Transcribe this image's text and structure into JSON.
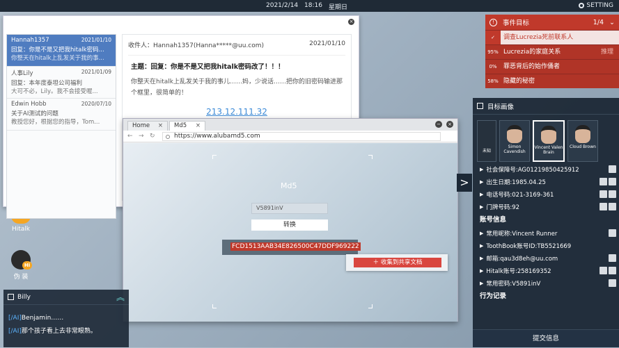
{
  "topbar": {
    "date": "2021/2/14",
    "time": "18:16",
    "weekday": "星期日",
    "settings_label": "SETTING"
  },
  "desktop": {
    "hitalk_label": "Hitalk",
    "hitalk_badge": "Hi",
    "disguise_label": "伪 装",
    "disguise_badge": "Hi"
  },
  "mail": {
    "close": "×",
    "list": [
      {
        "sender": "Hannah1357",
        "date": "2021/01/10",
        "subject": "回复：你是不是又把我hitalk密码...",
        "preview": "你整天在hitalk上乱发关于我的事..."
      },
      {
        "sender": "人事Lily",
        "date": "2021/01/09",
        "subject": "回复：本年度泰坦公司福利",
        "preview": "大可不必，Lily。我不会接受喔..."
      },
      {
        "sender": "Edwin Hobb",
        "date": "2020/07/10",
        "subject": "关于AI测试的问题",
        "preview": "教授您好，根据您的指导，Tom..."
      }
    ],
    "body": {
      "to": "收件人：Hannah1357(Hanna*****@uu.com)",
      "date": "2021/01/10",
      "subject": "主题：回复：你是不是又把我hitalk密码改了！！！",
      "text": "你整天在hitalk上乱发关于我的事儿……妈，少说话……把你的旧密码输进那个框里，很简单的！",
      "link": "213.12.111.32"
    }
  },
  "browser": {
    "tabs": [
      {
        "label": "Home",
        "close": "×"
      },
      {
        "label": "Md5",
        "close": "×"
      }
    ],
    "min": "−",
    "close": "×",
    "nav": {
      "back": "←",
      "forward": "→",
      "reload": "↻"
    },
    "url": "https://www.alubamd5.com",
    "page": {
      "title": "Md5",
      "input_value": "V5891inV",
      "convert_label": "转换",
      "hash": "FCD1513AAB34E826500C47DDF969222",
      "save_label": "＋ 收集到共享文档"
    }
  },
  "chat": {
    "icon": "grid-icon",
    "name": "Billy",
    "collapse": "︽",
    "lines": [
      {
        "tag": "[/AI]",
        "text": "Benjamin……"
      },
      {
        "tag": "[/AI]",
        "text": "那个孩子看上去非常眼熟。"
      }
    ]
  },
  "objectives": {
    "title": "事件目标",
    "count": "1/4",
    "close": "⌄",
    "items": [
      {
        "badge": "✓",
        "text": "调查Lucrezia死前联系人",
        "done": true
      },
      {
        "badge": "95%",
        "text": "Lucrezia的家庭关系",
        "hint": "推理"
      },
      {
        "badge": "0%",
        "text": "罪恶背后的始作俑者"
      },
      {
        "badge": "58%",
        "text": "隐藏的秘密"
      }
    ]
  },
  "profile": {
    "title": "目标画像",
    "toggle": ">",
    "portraits": [
      {
        "name": "未知"
      },
      {
        "name": "Simon Cavendish"
      },
      {
        "name": "Vincent Valen Brain"
      },
      {
        "name": "Cloud Brown"
      }
    ],
    "lines_top": [
      {
        "label": "社会保障号:AG01219850425912",
        "actions": 1
      },
      {
        "label": "出生日期:1985.04.25",
        "actions": 2
      },
      {
        "label": "电话号码:021-3169-361",
        "actions": 2
      },
      {
        "label": "门牌号码:92",
        "actions": 2
      }
    ],
    "section_accounts": "账号信息",
    "lines_accounts": [
      {
        "label": "常用昵称:Vincent Runner",
        "actions": 1
      },
      {
        "label": "ToothBook账号ID:TB5521669",
        "actions": 0
      },
      {
        "label": "邮箱:qau3d8eh@uu.com",
        "actions": 1
      },
      {
        "label": "Hitalk账号:258169352",
        "actions": 2
      },
      {
        "label": "常用密码:V5891inV",
        "actions": 1
      }
    ],
    "section_behavior": "行为记录",
    "submit": "提交信息"
  }
}
